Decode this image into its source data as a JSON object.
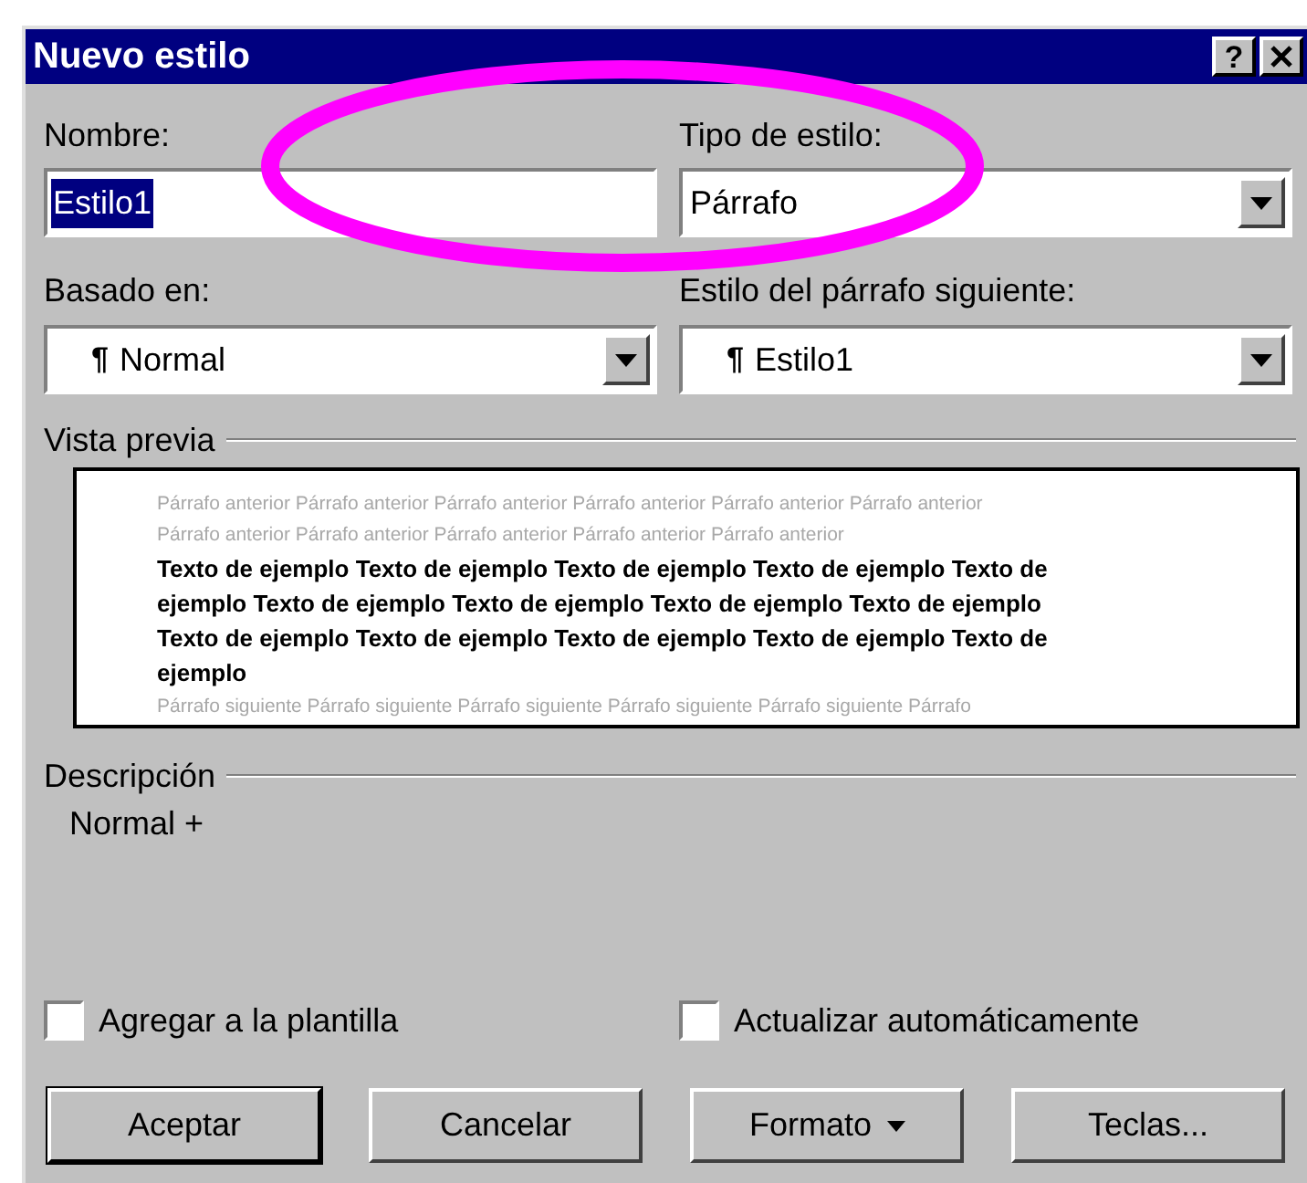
{
  "window": {
    "title": "Nuevo estilo",
    "buttons": [
      {
        "kind": "help",
        "label": "?"
      },
      {
        "kind": "close"
      }
    ]
  },
  "name": {
    "label": "Nombre:",
    "value": "Estilo1",
    "selected": true
  },
  "style_type": {
    "label": "Tipo de estilo:",
    "value": "Párrafo"
  },
  "based_on": {
    "label": "Basado en:",
    "mark": "¶",
    "value": "Normal"
  },
  "next_style": {
    "label": "Estilo del párrafo siguiente:",
    "mark": "¶",
    "value": "Estilo1"
  },
  "preview": {
    "label": "Vista previa",
    "previous_lines": [
      "Párrafo anterior Párrafo anterior Párrafo anterior Párrafo anterior Párrafo anterior Párrafo anterior",
      "Párrafo anterior Párrafo anterior Párrafo anterior Párrafo anterior Párrafo anterior"
    ],
    "sample_lines": [
      "Texto de ejemplo Texto de ejemplo Texto de ejemplo Texto de ejemplo Texto de",
      "ejemplo Texto de ejemplo Texto de ejemplo Texto de ejemplo Texto de ejemplo",
      "Texto de ejemplo Texto de ejemplo Texto de ejemplo Texto de ejemplo Texto de",
      "ejemplo"
    ],
    "following_lines": [
      "Párrafo siguiente Párrafo siguiente Párrafo siguiente Párrafo siguiente Párrafo siguiente Párrafo"
    ]
  },
  "description": {
    "label": "Descripción",
    "text": "Normal +"
  },
  "options": [
    {
      "label": "Agregar a la plantilla",
      "checked": false
    },
    {
      "label": "Actualizar automáticamente",
      "checked": false
    }
  ],
  "buttons": [
    {
      "label": "Aceptar",
      "kind": "default"
    },
    {
      "label": "Cancelar",
      "kind": "plain"
    },
    {
      "label": "Formato",
      "kind": "menu"
    },
    {
      "label": "Teclas...",
      "kind": "plain"
    }
  ],
  "annotation": {
    "kind": "ellipse"
  }
}
